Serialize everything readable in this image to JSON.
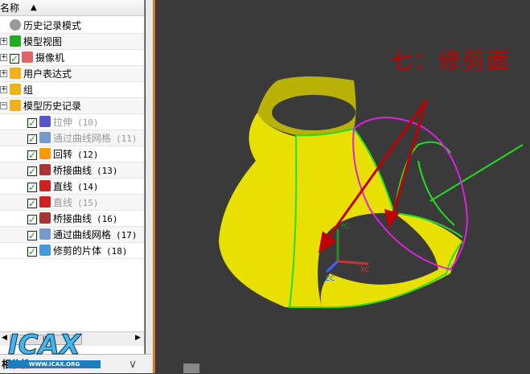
{
  "navigator": {
    "column_header": "名称",
    "sort_indicator": "▲",
    "items": [
      {
        "label": "历史记录模式",
        "icon": "clock-icon"
      },
      {
        "label": "模型视图",
        "icon": "model-view-icon",
        "expand": "+"
      },
      {
        "label": "摄像机",
        "icon": "camera-icon",
        "expand": "+",
        "checked": true
      },
      {
        "label": "用户表达式",
        "icon": "folder-icon",
        "expand": "+"
      },
      {
        "label": "组",
        "icon": "folder-icon",
        "expand": "+"
      },
      {
        "label": "模型历史记录",
        "icon": "folder-open-icon",
        "expand": "−"
      },
      {
        "label": "拉伸",
        "num": "(10)",
        "icon": "extrude-icon",
        "dim": true
      },
      {
        "label": "通过曲线网格",
        "num": "(11)",
        "icon": "mesh-surface-icon",
        "dim": true
      },
      {
        "label": "回转",
        "num": "(12)",
        "icon": "revolve-icon"
      },
      {
        "label": "桥接曲线",
        "num": "(13)",
        "icon": "bridge-curve-icon"
      },
      {
        "label": "直线",
        "num": "(14)",
        "icon": "line-icon"
      },
      {
        "label": "直线",
        "num": "(15)",
        "icon": "line-icon",
        "dim": true
      },
      {
        "label": "桥接曲线",
        "num": "(16)",
        "icon": "bridge-curve-icon"
      },
      {
        "label": "通过曲线网格",
        "num": "(17)",
        "icon": "mesh-surface-icon"
      },
      {
        "label": "修剪的片体",
        "num": "(18)",
        "icon": "trimmed-sheet-icon"
      }
    ],
    "bottom_panel_label": "相依性",
    "scroll_thumb_label": "III"
  },
  "viewport": {
    "annotation": "七：修剪面",
    "axes": {
      "x": "XC",
      "y": "YC",
      "z": "ZC"
    }
  },
  "watermark": {
    "logo": "ICAX",
    "url": "WWW.ICAX.ORG"
  },
  "colors": {
    "surface": "#e8e000",
    "edges": "#22dd22",
    "trim_curve": "#e020e0",
    "arrow": "#c00000"
  }
}
